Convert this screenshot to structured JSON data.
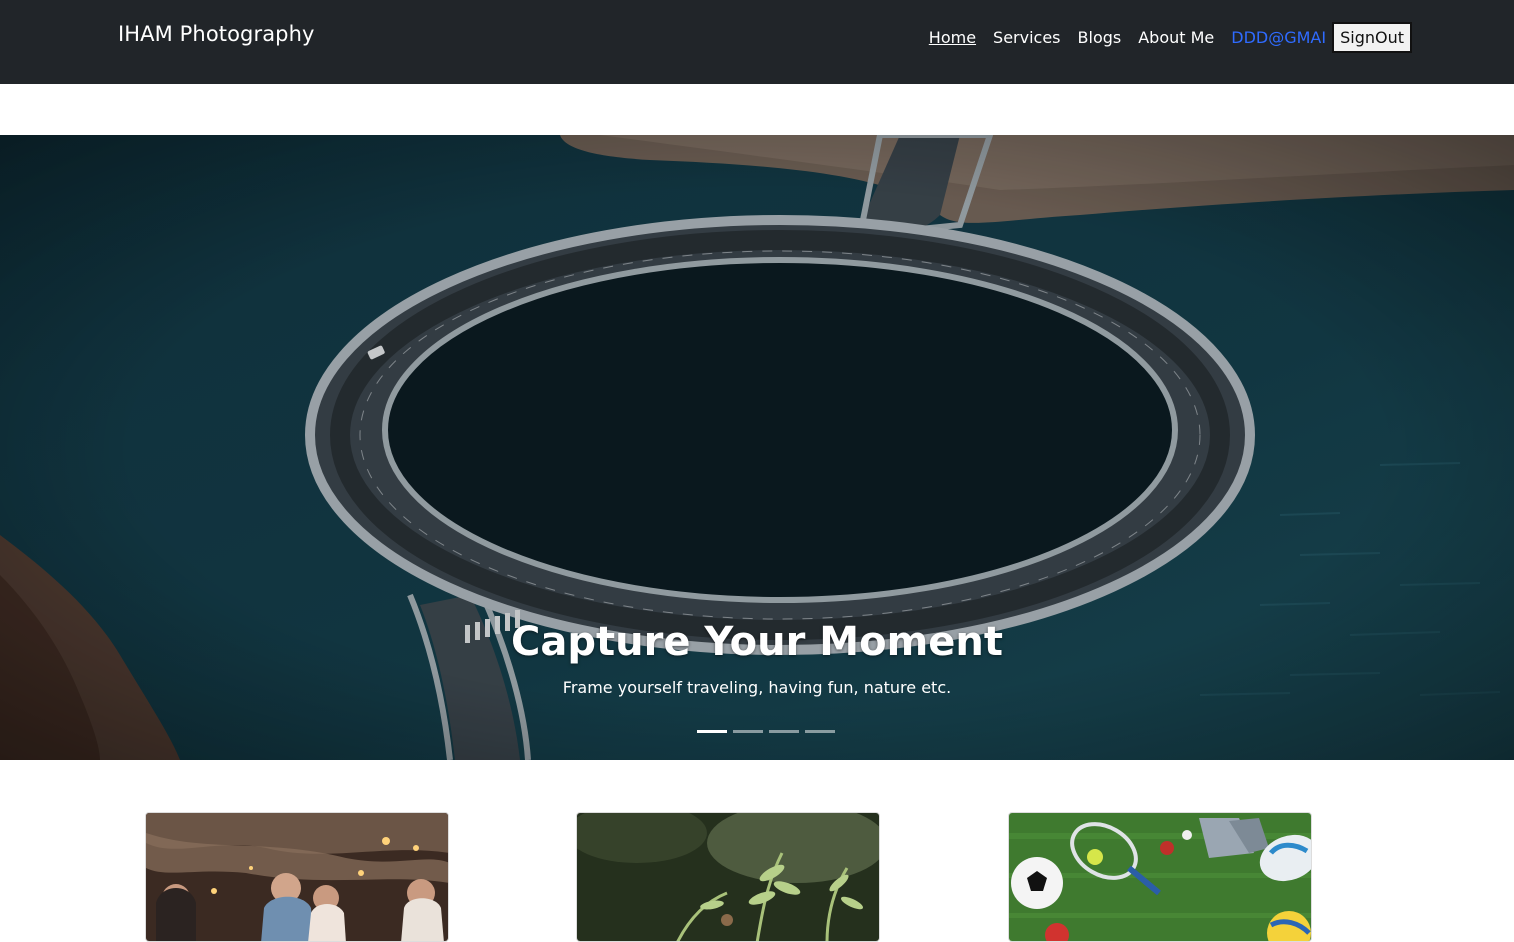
{
  "navbar": {
    "brand": "IHAM Photography",
    "links": [
      "Home",
      "Services",
      "Blogs",
      "About Me"
    ],
    "active_link": "Home",
    "user": "DDD@GMAI",
    "signout_label": "SignOut"
  },
  "hero": {
    "title": "Capture Your Moment",
    "subtitle": "Frame yourself traveling, having fun, nature etc.",
    "slide_count": 4,
    "active_slide": 1,
    "image": "aerial-circular-bridge-over-sea"
  },
  "cards": [
    {
      "image": "couple-with-sparklers-photo"
    },
    {
      "image": "fern-plant-nature-photo"
    },
    {
      "image": "sports-balls-on-grass-photo"
    }
  ],
  "colors": {
    "navbar_bg": "#212529",
    "user_link": "#2f6bff"
  }
}
